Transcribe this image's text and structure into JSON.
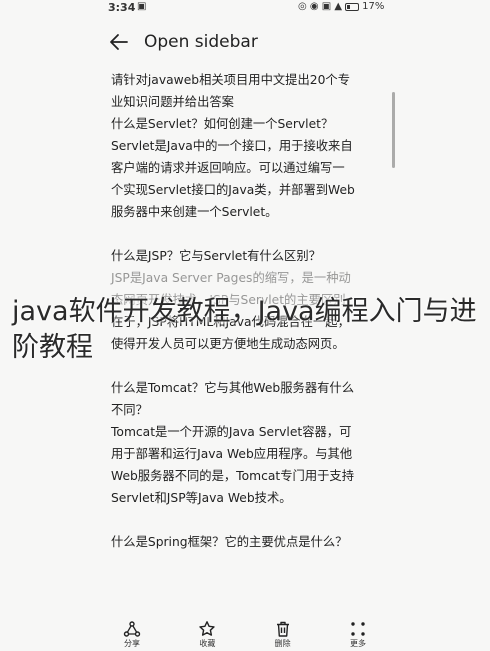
{
  "status_bar": {
    "time": "3:34",
    "notification_glyph": "▣",
    "icons": "◎ ◉ ▣ ▲",
    "battery": "17%"
  },
  "header": {
    "back_icon": "back-arrow-icon",
    "title": "Open sidebar"
  },
  "content": {
    "paragraphs": [
      [
        "请针对javaweb相关项目用中文提出20个专",
        "业知识问题并给出答案",
        "什么是Servlet？如何创建一个Servlet？",
        "Servlet是Java中的一个接口，用于接收来自",
        "客户端的请求并返回响应。可以通过编写一",
        "个实现Servlet接口的Java类，并部署到Web",
        "服务器中来创建一个Servlet。"
      ],
      [
        "什么是JSP？它与Servlet有什么区别？",
        "JSP是Java Server Pages的缩写，是一种动",
        "态网页开发技术。JSP与Servlet的主要区别",
        "在于，JSP将HTML和Java代码混合在一起，",
        "使得开发人员可以更方便地生成动态网页。"
      ],
      [
        "什么是Tomcat？它与其他Web服务器有什么",
        "不同？",
        "Tomcat是一个开源的Java Servlet容器，可",
        "用于部署和运行Java Web应用程序。与其他",
        "Web服务器不同的是，Tomcat专门用于支持",
        "Servlet和JSP等Java Web技术。"
      ],
      [
        "什么是Spring框架？它的主要优点是什么？"
      ]
    ]
  },
  "overlay": {
    "title": "java软件开发教程，Java编程入门与进阶教程"
  },
  "bottom_bar": {
    "share": "分享",
    "favorite": "收藏",
    "delete": "删除",
    "more": "更多"
  }
}
